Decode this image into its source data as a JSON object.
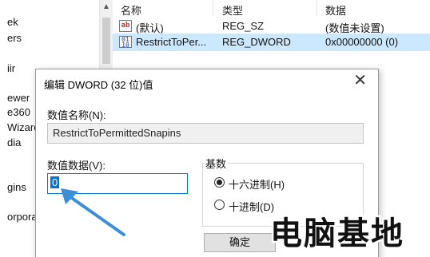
{
  "tree": {
    "items": [
      "ek",
      "ers",
      "iir",
      "ewer",
      "e360",
      "Wizard",
      "dia",
      "gins",
      "orporat"
    ]
  },
  "values": {
    "headers": {
      "name": "名称",
      "type": "类型",
      "data": "数据"
    },
    "rows": [
      {
        "icon": "string-value-icon",
        "icon_text": "ab",
        "name": "(默认)",
        "type": "REG_SZ",
        "data": "(数值未设置)",
        "selected": false
      },
      {
        "icon": "dword-value-icon",
        "icon_text": "011\n110",
        "name": "RestrictToPer...",
        "type": "REG_DWORD",
        "data": "0x00000000 (0)",
        "selected": true
      }
    ]
  },
  "dialog": {
    "title": "编辑 DWORD (32 位)值",
    "close_glyph": "✕",
    "value_name_label": "数值名称(N):",
    "value_name": "RestrictToPermittedSnapins",
    "value_data_label": "数值数据(V):",
    "value_data": "0",
    "base_label": "基数",
    "base_options": [
      {
        "label": "十六进制(H)",
        "checked": true
      },
      {
        "label": "十进制(D)",
        "checked": false
      }
    ],
    "ok_label": "确定"
  },
  "annotation": {
    "color": "#3a8fd6",
    "icon": "arrow-pointer-icon"
  },
  "watermark": {
    "text": "电脑基地"
  },
  "colors": {
    "selection": "#cce8ff",
    "accent": "#0078d7"
  }
}
